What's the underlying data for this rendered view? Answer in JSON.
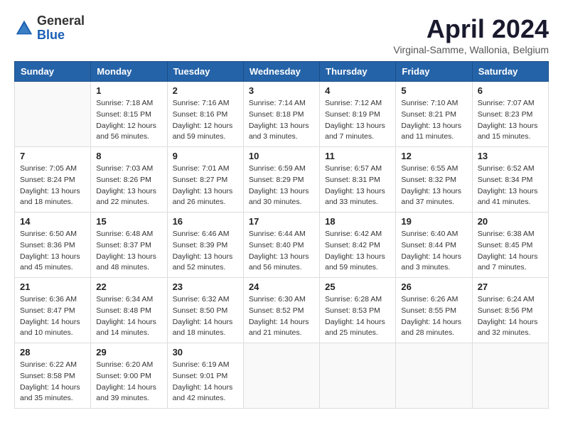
{
  "logo": {
    "general": "General",
    "blue": "Blue"
  },
  "header": {
    "title": "April 2024",
    "subtitle": "Virginal-Samme, Wallonia, Belgium"
  },
  "days_of_week": [
    "Sunday",
    "Monday",
    "Tuesday",
    "Wednesday",
    "Thursday",
    "Friday",
    "Saturday"
  ],
  "weeks": [
    [
      {
        "day": "",
        "info": ""
      },
      {
        "day": "1",
        "info": "Sunrise: 7:18 AM\nSunset: 8:15 PM\nDaylight: 12 hours\nand 56 minutes."
      },
      {
        "day": "2",
        "info": "Sunrise: 7:16 AM\nSunset: 8:16 PM\nDaylight: 12 hours\nand 59 minutes."
      },
      {
        "day": "3",
        "info": "Sunrise: 7:14 AM\nSunset: 8:18 PM\nDaylight: 13 hours\nand 3 minutes."
      },
      {
        "day": "4",
        "info": "Sunrise: 7:12 AM\nSunset: 8:19 PM\nDaylight: 13 hours\nand 7 minutes."
      },
      {
        "day": "5",
        "info": "Sunrise: 7:10 AM\nSunset: 8:21 PM\nDaylight: 13 hours\nand 11 minutes."
      },
      {
        "day": "6",
        "info": "Sunrise: 7:07 AM\nSunset: 8:23 PM\nDaylight: 13 hours\nand 15 minutes."
      }
    ],
    [
      {
        "day": "7",
        "info": "Sunrise: 7:05 AM\nSunset: 8:24 PM\nDaylight: 13 hours\nand 18 minutes."
      },
      {
        "day": "8",
        "info": "Sunrise: 7:03 AM\nSunset: 8:26 PM\nDaylight: 13 hours\nand 22 minutes."
      },
      {
        "day": "9",
        "info": "Sunrise: 7:01 AM\nSunset: 8:27 PM\nDaylight: 13 hours\nand 26 minutes."
      },
      {
        "day": "10",
        "info": "Sunrise: 6:59 AM\nSunset: 8:29 PM\nDaylight: 13 hours\nand 30 minutes."
      },
      {
        "day": "11",
        "info": "Sunrise: 6:57 AM\nSunset: 8:31 PM\nDaylight: 13 hours\nand 33 minutes."
      },
      {
        "day": "12",
        "info": "Sunrise: 6:55 AM\nSunset: 8:32 PM\nDaylight: 13 hours\nand 37 minutes."
      },
      {
        "day": "13",
        "info": "Sunrise: 6:52 AM\nSunset: 8:34 PM\nDaylight: 13 hours\nand 41 minutes."
      }
    ],
    [
      {
        "day": "14",
        "info": "Sunrise: 6:50 AM\nSunset: 8:36 PM\nDaylight: 13 hours\nand 45 minutes."
      },
      {
        "day": "15",
        "info": "Sunrise: 6:48 AM\nSunset: 8:37 PM\nDaylight: 13 hours\nand 48 minutes."
      },
      {
        "day": "16",
        "info": "Sunrise: 6:46 AM\nSunset: 8:39 PM\nDaylight: 13 hours\nand 52 minutes."
      },
      {
        "day": "17",
        "info": "Sunrise: 6:44 AM\nSunset: 8:40 PM\nDaylight: 13 hours\nand 56 minutes."
      },
      {
        "day": "18",
        "info": "Sunrise: 6:42 AM\nSunset: 8:42 PM\nDaylight: 13 hours\nand 59 minutes."
      },
      {
        "day": "19",
        "info": "Sunrise: 6:40 AM\nSunset: 8:44 PM\nDaylight: 14 hours\nand 3 minutes."
      },
      {
        "day": "20",
        "info": "Sunrise: 6:38 AM\nSunset: 8:45 PM\nDaylight: 14 hours\nand 7 minutes."
      }
    ],
    [
      {
        "day": "21",
        "info": "Sunrise: 6:36 AM\nSunset: 8:47 PM\nDaylight: 14 hours\nand 10 minutes."
      },
      {
        "day": "22",
        "info": "Sunrise: 6:34 AM\nSunset: 8:48 PM\nDaylight: 14 hours\nand 14 minutes."
      },
      {
        "day": "23",
        "info": "Sunrise: 6:32 AM\nSunset: 8:50 PM\nDaylight: 14 hours\nand 18 minutes."
      },
      {
        "day": "24",
        "info": "Sunrise: 6:30 AM\nSunset: 8:52 PM\nDaylight: 14 hours\nand 21 minutes."
      },
      {
        "day": "25",
        "info": "Sunrise: 6:28 AM\nSunset: 8:53 PM\nDaylight: 14 hours\nand 25 minutes."
      },
      {
        "day": "26",
        "info": "Sunrise: 6:26 AM\nSunset: 8:55 PM\nDaylight: 14 hours\nand 28 minutes."
      },
      {
        "day": "27",
        "info": "Sunrise: 6:24 AM\nSunset: 8:56 PM\nDaylight: 14 hours\nand 32 minutes."
      }
    ],
    [
      {
        "day": "28",
        "info": "Sunrise: 6:22 AM\nSunset: 8:58 PM\nDaylight: 14 hours\nand 35 minutes."
      },
      {
        "day": "29",
        "info": "Sunrise: 6:20 AM\nSunset: 9:00 PM\nDaylight: 14 hours\nand 39 minutes."
      },
      {
        "day": "30",
        "info": "Sunrise: 6:19 AM\nSunset: 9:01 PM\nDaylight: 14 hours\nand 42 minutes."
      },
      {
        "day": "",
        "info": ""
      },
      {
        "day": "",
        "info": ""
      },
      {
        "day": "",
        "info": ""
      },
      {
        "day": "",
        "info": ""
      }
    ]
  ]
}
